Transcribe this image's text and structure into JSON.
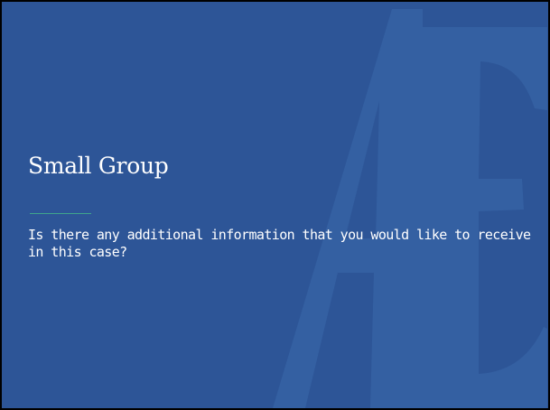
{
  "slide": {
    "title": "Small Group",
    "body": "Is there any additional information that you would like to receive in this case?",
    "background_color": "#2d5597",
    "watermark_color": "#3460a2",
    "divider_color": "#3fa58c",
    "watermark_icon": "ae-monogram-icon"
  }
}
